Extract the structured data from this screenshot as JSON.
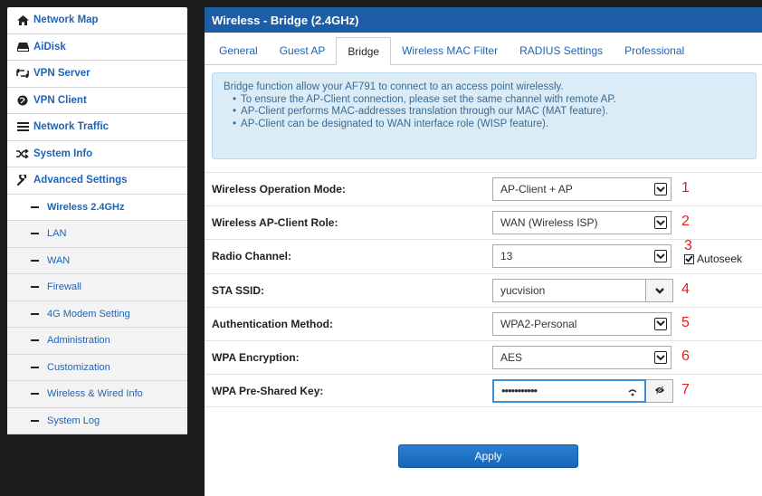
{
  "sidebar": {
    "items": [
      {
        "label": "Network Map",
        "icon": "home-icon"
      },
      {
        "label": "AiDisk",
        "icon": "disk-icon"
      },
      {
        "label": "VPN Server",
        "icon": "vpn-server-icon"
      },
      {
        "label": "VPN Client",
        "icon": "globe-icon"
      },
      {
        "label": "Network Traffic",
        "icon": "list-icon"
      },
      {
        "label": "System Info",
        "icon": "shuffle-icon"
      },
      {
        "label": "Advanced Settings",
        "icon": "wrench-icon"
      }
    ],
    "sub_items": [
      "Wireless 2.4GHz",
      "LAN",
      "WAN",
      "Firewall",
      "4G Modem Setting",
      "Administration",
      "Customization",
      "Wireless & Wired Info",
      "System Log"
    ]
  },
  "panel": {
    "title": "Wireless - Bridge (2.4GHz)",
    "tabs": [
      "General",
      "Guest AP",
      "Bridge",
      "Wireless MAC Filter",
      "RADIUS Settings",
      "Professional"
    ],
    "active_tab": "Bridge"
  },
  "info": {
    "intro": "Bridge function allow your AF791 to connect to an access point wirelessly.",
    "bullets": [
      "To ensure the AP-Client connection, please set the same channel with remote AP.",
      "AP-Client performs MAC-addresses translation through our MAC (MAT feature).",
      "AP-Client can be designated to WAN interface role (WISP feature)."
    ]
  },
  "form": {
    "operation_mode": {
      "label": "Wireless Operation Mode:",
      "value": "AP-Client + AP",
      "annotation": "1"
    },
    "client_role": {
      "label": "Wireless AP-Client Role:",
      "value": "WAN (Wireless ISP)",
      "annotation": "2"
    },
    "radio_channel": {
      "label": "Radio Channel:",
      "value": "13",
      "annotation": "3",
      "autoseek_label": "Autoseek",
      "autoseek_checked": true
    },
    "sta_ssid": {
      "label": "STA SSID:",
      "value": "yucvision",
      "annotation": "4"
    },
    "auth_method": {
      "label": "Authentication Method:",
      "value": "WPA2-Personal",
      "annotation": "5"
    },
    "wpa_encryption": {
      "label": "WPA Encryption:",
      "value": "AES",
      "annotation": "6"
    },
    "psk": {
      "label": "WPA Pre-Shared Key:",
      "value": "•••••••••••",
      "annotation": "7"
    }
  },
  "apply_label": "Apply",
  "colors": {
    "header": "#1d5ea6",
    "link": "#1f63b5",
    "info_bg": "#dcecf7",
    "annotation": "#e02020",
    "apply": "#1766b8"
  }
}
